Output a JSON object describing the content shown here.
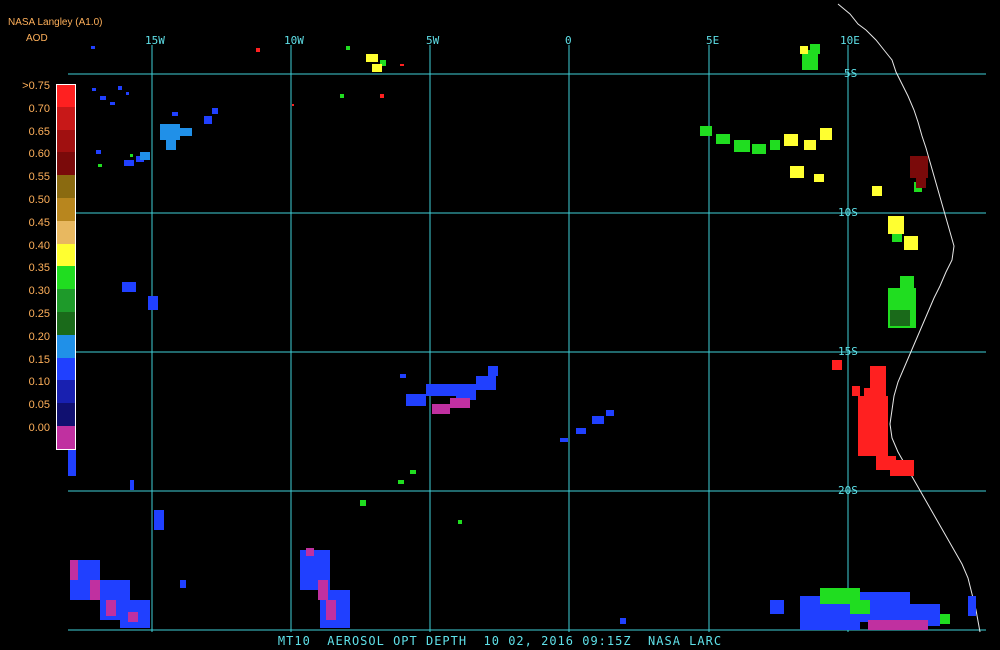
{
  "header": {
    "source": "NASA Langley (A1.0)",
    "product": "AOD"
  },
  "legend": {
    "labels": [
      ">0.75",
      "0.70",
      "0.65",
      "0.60",
      "0.55",
      "0.50",
      "0.45",
      "0.40",
      "0.35",
      "0.30",
      "0.25",
      "0.20",
      "0.15",
      "0.10",
      "0.05",
      "0.00"
    ],
    "colors": [
      "#ff2020",
      "#c81818",
      "#a01010",
      "#7a0a0a",
      "#8a6a10",
      "#b8861e",
      "#e8b860",
      "#ffff30",
      "#20dd20",
      "#1e9a2a",
      "#1a6a1a",
      "#2090e8",
      "#2040ff",
      "#1820b0",
      "#101070",
      "#c030a0"
    ]
  },
  "grid": {
    "lon_labels": [
      "15W",
      "10W",
      "5W",
      "0",
      "5E",
      "10E"
    ],
    "lat_labels": [
      "5S",
      "10S",
      "15S",
      "20S"
    ]
  },
  "footer": {
    "text": "MT10  AEROSOL OPT DEPTH  10 02, 2016 09:15Z  NASA LARC"
  }
}
